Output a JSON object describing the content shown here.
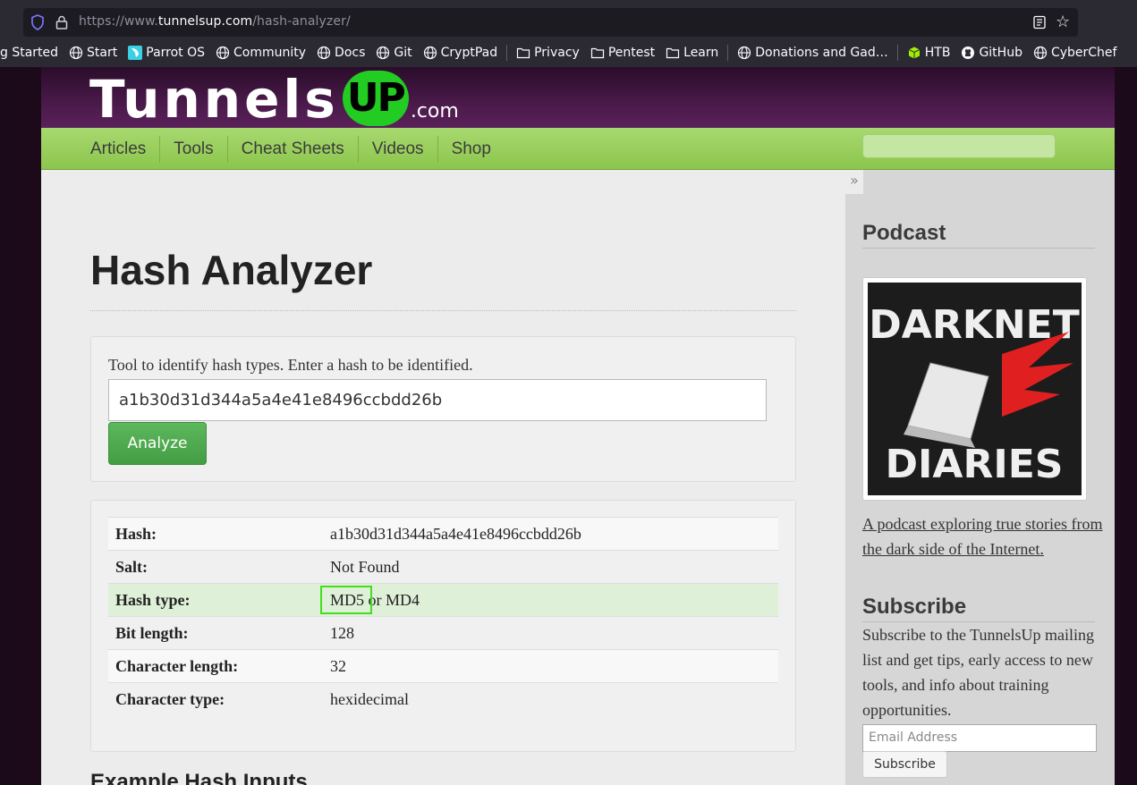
{
  "browser": {
    "url_prefix": "https://www.",
    "url_host": "tunnelsup.com",
    "url_path": "/hash-analyzer/",
    "bookmarks": [
      {
        "label": "g Started",
        "icon": "none"
      },
      {
        "label": "Start",
        "icon": "globe-icon"
      },
      {
        "label": "Parrot OS",
        "icon": "parrot-icon"
      },
      {
        "label": "Community",
        "icon": "globe-icon"
      },
      {
        "label": "Docs",
        "icon": "globe-icon"
      },
      {
        "label": "Git",
        "icon": "globe-icon"
      },
      {
        "label": "CryptPad",
        "icon": "globe-icon"
      },
      {
        "label": "Privacy",
        "icon": "folder-icon"
      },
      {
        "label": "Pentest",
        "icon": "folder-icon"
      },
      {
        "label": "Learn",
        "icon": "folder-icon"
      },
      {
        "label": "Donations and Gad…",
        "icon": "globe-icon"
      },
      {
        "label": "HTB",
        "icon": "htb-cube-icon"
      },
      {
        "label": "GitHub",
        "icon": "github-icon"
      },
      {
        "label": "CyberChef",
        "icon": "globe-icon"
      }
    ]
  },
  "site": {
    "logo_text": "Tunnels",
    "logo_up": "UP",
    "logo_com": ".com",
    "nav": [
      "Articles",
      "Tools",
      "Cheat Sheets",
      "Videos",
      "Shop"
    ],
    "collapse": "»"
  },
  "main": {
    "title": "Hash Analyzer",
    "tool_desc": "Tool to identify hash types. Enter a hash to be identified.",
    "hash_value": "a1b30d31d344a5a4e41e8496ccbdd26b",
    "analyze_label": "Analyze",
    "results": [
      {
        "key": "Hash:",
        "value": "a1b30d31d344a5a4e41e8496ccbdd26b"
      },
      {
        "key": "Salt:",
        "value": "Not Found"
      },
      {
        "key": "Hash type:",
        "value": "MD5 or MD4"
      },
      {
        "key": "Bit length:",
        "value": "128"
      },
      {
        "key": "Character length:",
        "value": "32"
      },
      {
        "key": "Character type:",
        "value": "hexidecimal"
      }
    ],
    "example_title": "Example Hash Inputs"
  },
  "sidebar": {
    "podcast_heading": "Podcast",
    "podcast_art_top": "DARKNET",
    "podcast_art_bottom": "DIARIES",
    "podcast_link": "A podcast exploring true stories from the dark side of the Internet.",
    "subscribe_heading": "Subscribe",
    "subscribe_text": "Subscribe to the TunnelsUp mailing list and get tips, early access to new tools, and info about training opportunities.",
    "email_placeholder": "Email Address",
    "subscribe_label": "Subscribe"
  },
  "colors": {
    "nav_green": "#8cc64c",
    "header_purple": "#4a1a4a",
    "analyze_green": "#5cb85c",
    "highlight_row": "#dff0d8",
    "highlight_box": "#44dd22"
  }
}
